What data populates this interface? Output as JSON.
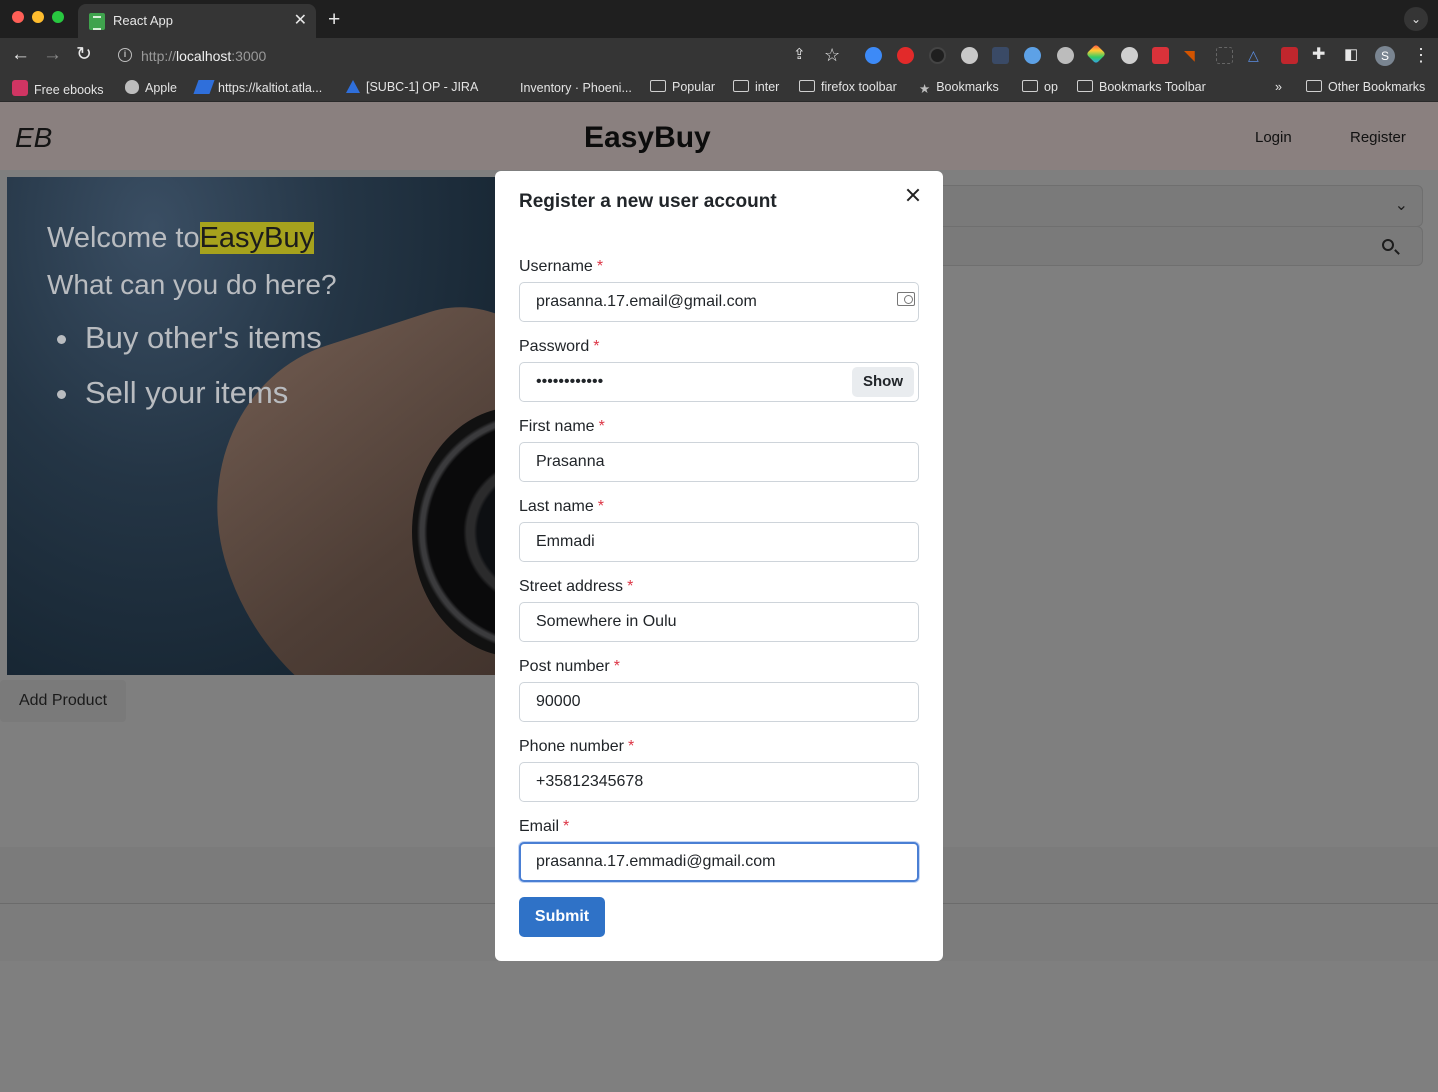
{
  "browser": {
    "tab_title": "React App",
    "url_scheme": "http://",
    "url_host": "localhost",
    "url_port": ":3000",
    "avatar_initial": "S",
    "bookmarks": [
      {
        "label": "Free ebooks",
        "icon": "it-badge-icon"
      },
      {
        "label": "Apple",
        "icon": "apple-icon"
      },
      {
        "label": "https://kaltiot.atla...",
        "icon": "jira-icon"
      },
      {
        "label": "[SUBC-1] OP - JIRA",
        "icon": "atlassian-icon"
      },
      {
        "label": "Inventory · Phoeni...",
        "icon": "phoenix-icon"
      },
      {
        "label": "Popular",
        "icon": "folder-icon"
      },
      {
        "label": "inter",
        "icon": "folder-icon"
      },
      {
        "label": "firefox toolbar",
        "icon": "folder-icon"
      },
      {
        "label": "Bookmarks",
        "icon": "star-icon"
      },
      {
        "label": "op",
        "icon": "folder-icon"
      },
      {
        "label": "Bookmarks Toolbar",
        "icon": "folder-icon"
      }
    ],
    "bookmarks_overflow": "»",
    "other_bookmarks": "Other Bookmarks"
  },
  "app": {
    "brand_short": "EB",
    "brand": "EasyBuy",
    "nav": {
      "login": "Login",
      "register": "Register"
    },
    "hero": {
      "welcome": "Welcome to",
      "welcome_highlight": "EasyBuy",
      "subtitle": "What can you do here?",
      "bullets": [
        "Buy other's items",
        "Sell your items"
      ]
    },
    "add_product": "Add Product"
  },
  "modal": {
    "title": "Register a new user account",
    "fields": {
      "username": {
        "label": "Username",
        "value": "prasanna.17.email@gmail.com"
      },
      "password": {
        "label": "Password",
        "value": "••••••••••••",
        "show_label": "Show"
      },
      "first_name": {
        "label": "First name",
        "value": "Prasanna"
      },
      "last_name": {
        "label": "Last name",
        "value": "Emmadi"
      },
      "street_address": {
        "label": "Street address",
        "value": "Somewhere in Oulu"
      },
      "post_number": {
        "label": "Post number",
        "value": "90000"
      },
      "phone_number": {
        "label": "Phone number",
        "value": "+35812345678"
      },
      "email": {
        "label": "Email",
        "value": "prasanna.17.emmadi@gmail.com"
      }
    },
    "required_marker": "*",
    "submit": "Submit"
  }
}
